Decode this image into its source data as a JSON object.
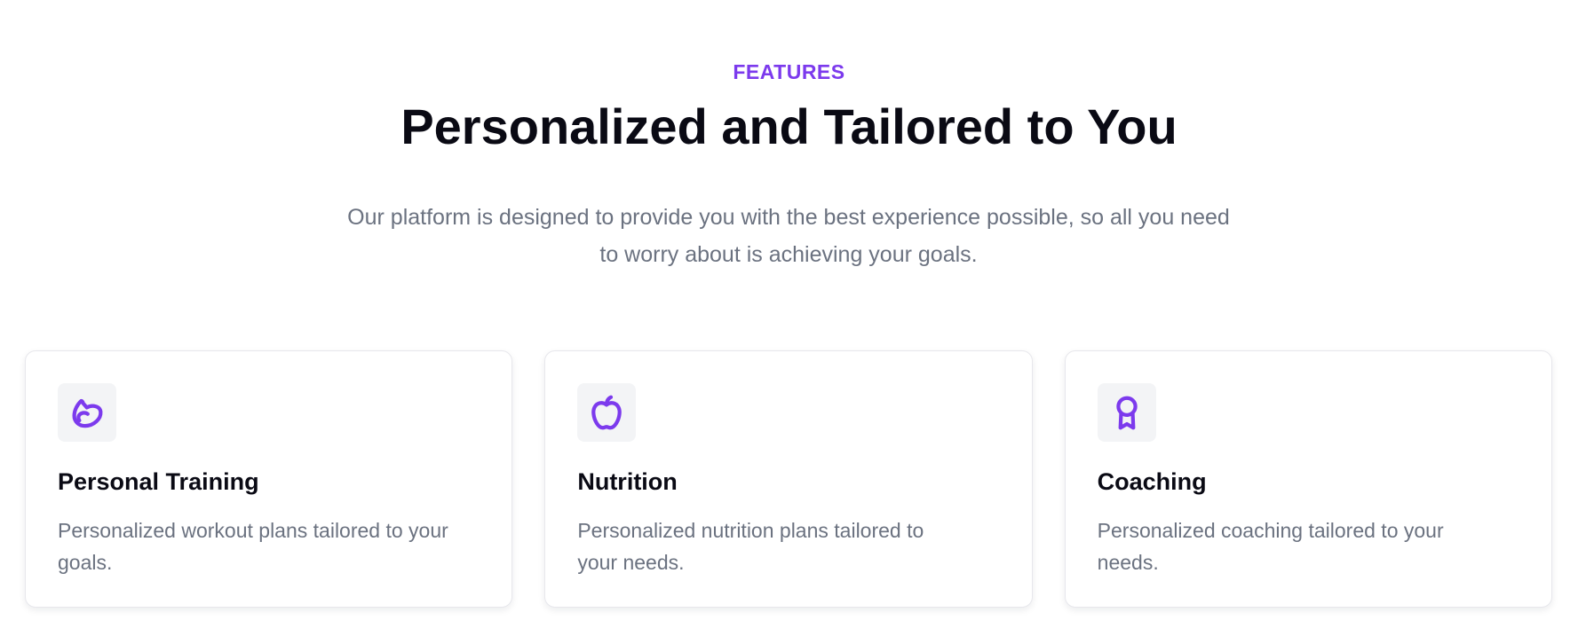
{
  "section": {
    "eyebrow": "FEATURES",
    "title": "Personalized and Tailored to You",
    "subtitle": "Our platform is designed to provide you with the best experience possible, so all you need to worry about is achieving your goals."
  },
  "colors": {
    "accent": "#7c3aed",
    "icon_bg": "#f3f4f6",
    "muted_text": "#6b7280",
    "heading_text": "#0a0a14"
  },
  "features": [
    {
      "icon": "flexed-bicep-icon",
      "title": "Personal Training",
      "description": "Personalized workout plans tailored to your goals."
    },
    {
      "icon": "apple-icon",
      "title": "Nutrition",
      "description": "Personalized nutrition plans tailored to your needs."
    },
    {
      "icon": "award-ribbon-icon",
      "title": "Coaching",
      "description": "Personalized coaching tailored to your needs."
    }
  ]
}
